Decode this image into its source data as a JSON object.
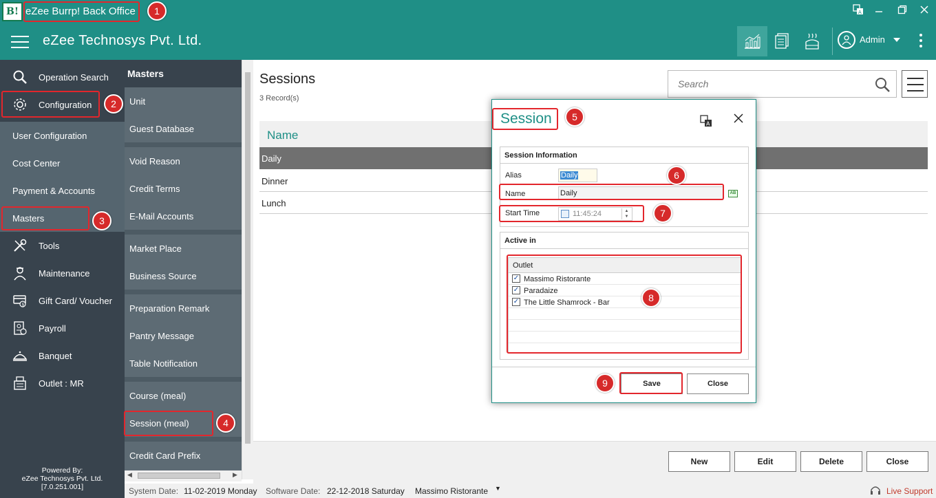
{
  "window": {
    "logo_text": "B!",
    "title": "eZee Burrp! Back Office",
    "controls": [
      "translate-icon",
      "minimize-icon",
      "restore-icon",
      "close-icon"
    ]
  },
  "header": {
    "company": "eZee Technosys Pvt. Ltd.",
    "user": "Admin",
    "icons": [
      "chart-icon",
      "report-icon",
      "kitchen-icon"
    ]
  },
  "sidebar": {
    "items": [
      {
        "label": "Operation Search",
        "icon": "search-icon"
      },
      {
        "label": "Configuration",
        "icon": "gear-icon"
      },
      {
        "label": "User Configuration"
      },
      {
        "label": "Cost Center"
      },
      {
        "label": "Payment & Accounts"
      },
      {
        "label": "Masters"
      },
      {
        "label": "Tools",
        "icon": "tools-icon"
      },
      {
        "label": "Maintenance",
        "icon": "maintenance-icon"
      },
      {
        "label": "Gift Card/ Voucher",
        "icon": "giftcard-icon"
      },
      {
        "label": "Payroll",
        "icon": "payroll-icon"
      },
      {
        "label": "Banquet",
        "icon": "banquet-icon"
      },
      {
        "label": "Outlet : MR",
        "icon": "outlet-icon"
      }
    ],
    "powered_by": [
      "Powered By:",
      "eZee Technosys Pvt. Ltd.",
      "[7.0.251.001]"
    ]
  },
  "masters": {
    "title": "Masters",
    "items": [
      "Unit",
      "Guest Database",
      "Void Reason",
      "Credit Terms",
      "E-Mail Accounts",
      "Market Place",
      "Business Source",
      "Preparation Remark",
      "Pantry Message",
      "Table Notification",
      "Course (meal)",
      "Session (meal)",
      "Credit Card Prefix"
    ]
  },
  "main": {
    "title": "Sessions",
    "record_count": "3 Record(s)",
    "search_placeholder": "Search",
    "column_header": "Name",
    "rows": [
      "Daily",
      "Dinner",
      "Lunch"
    ],
    "buttons": {
      "new": "New",
      "edit": "Edit",
      "delete": "Delete",
      "close": "Close"
    }
  },
  "dialog": {
    "title": "Session",
    "group_info": "Session Information",
    "alias_label": "Alias",
    "alias_value": "Daily",
    "name_label": "Name",
    "name_value": "Daily",
    "start_time_label": "Start Time",
    "start_time_value": "11:45:24",
    "group_active": "Active in",
    "outlet_header": "Outlet",
    "outlets": [
      {
        "name": "Massimo Ristorante",
        "checked": true
      },
      {
        "name": "Paradaize",
        "checked": true
      },
      {
        "name": "The Little Shamrock - Bar",
        "checked": true
      }
    ],
    "save_label": "Save",
    "close_label": "Close",
    "ab_icon_text": "AB"
  },
  "status": {
    "system_date_label": "System Date:",
    "system_date": "11-02-2019 Monday",
    "software_date_label": "Software Date:",
    "software_date": "22-12-2018 Saturday",
    "outlet": "Massimo Ristorante",
    "live_support": "Live Support"
  },
  "annotations": [
    "1",
    "2",
    "3",
    "4",
    "5",
    "6",
    "7",
    "8",
    "9"
  ],
  "colors": {
    "teal": "#1f8f86",
    "nav_dark": "#38434d",
    "nav_sub": "#55656f",
    "annotation_red": "#e3262c",
    "selected_row": "#707070"
  }
}
